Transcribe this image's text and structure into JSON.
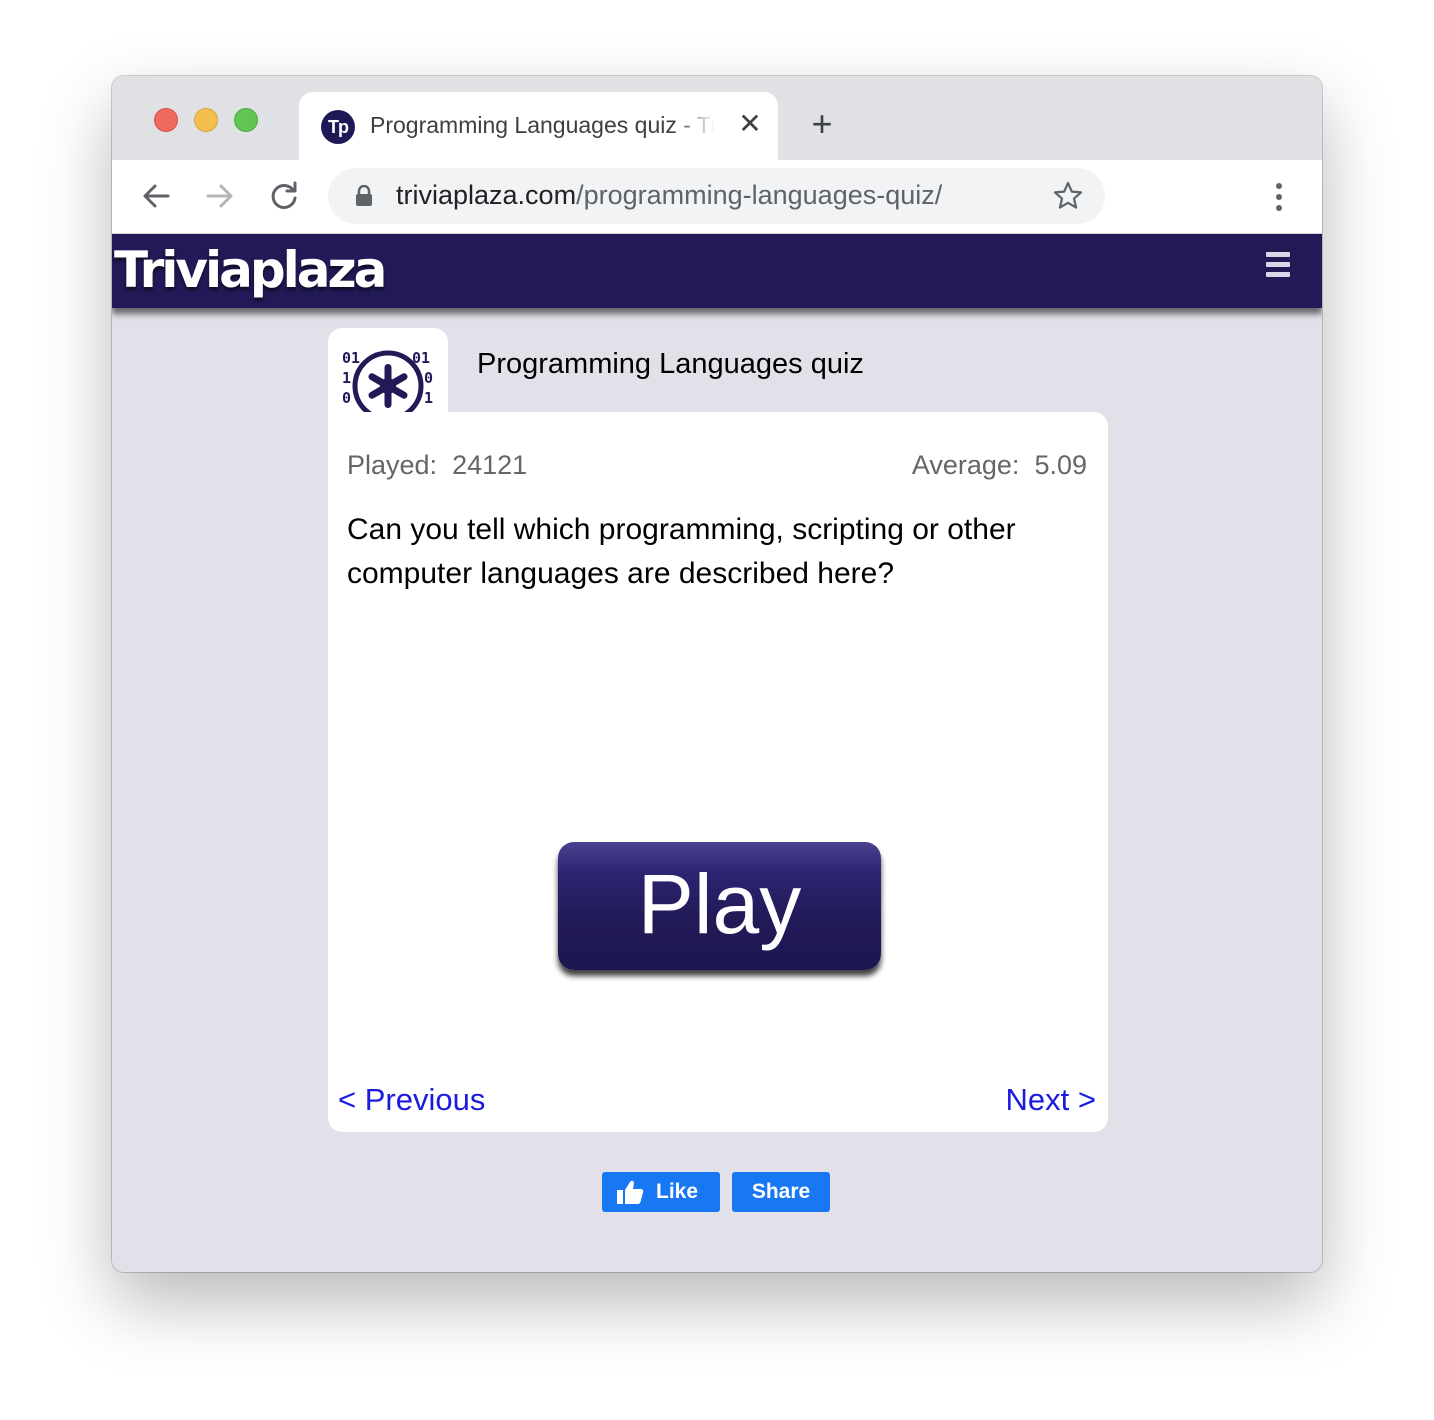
{
  "browser": {
    "tab_title": "Programming Languages quiz - Triviaplaza",
    "tab_favicon_text": "Tp",
    "tab_close_glyph": "✕",
    "new_tab_glyph": "+",
    "url_domain": "triviaplaza.com",
    "url_path": "/programming-languages-quiz/",
    "icons": [
      "back-arrow-icon",
      "forward-arrow-icon",
      "reload-icon",
      "lock-icon",
      "star-icon",
      "kebab-menu-icon"
    ]
  },
  "site": {
    "logo_text": "Triviaplaza",
    "header_color": "#211a57",
    "menu_icon": "hamburger-icon"
  },
  "quiz": {
    "title": "Programming Languages quiz",
    "icon": "binary-magnifier-icon",
    "played_label": "Played:",
    "played_value": "24121",
    "average_label": "Average:",
    "average_value": "5.09",
    "description": "Can you tell which programming, scripting or other computer languages are described here?",
    "play_label": "Play",
    "previous_label": "< Previous",
    "next_label": "Next >"
  },
  "social": {
    "like_label": "Like",
    "share_label": "Share",
    "brand_color": "#1877f2"
  }
}
